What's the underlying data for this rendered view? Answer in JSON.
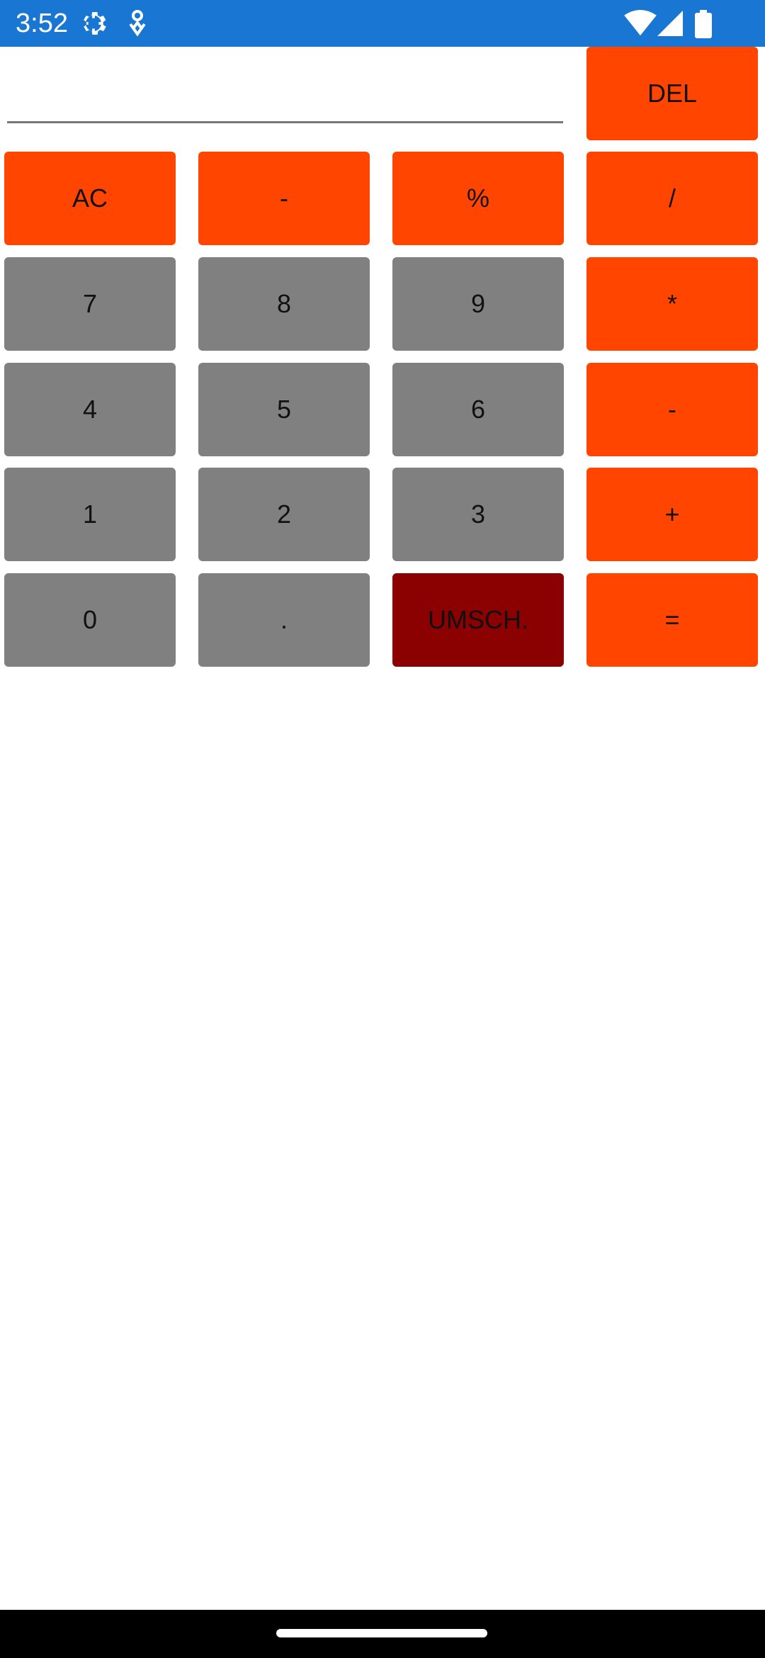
{
  "status_bar": {
    "time": "3:52",
    "left_icons": [
      "gear-icon",
      "assistant-icon"
    ],
    "right_icons": [
      "wifi-icon",
      "signal-icon",
      "battery-icon"
    ]
  },
  "display": {
    "value": "",
    "placeholder": ""
  },
  "keys": {
    "del": "DEL",
    "ac": "AC",
    "negate": "-",
    "percent": "%",
    "divide": "/",
    "seven": "7",
    "eight": "8",
    "nine": "9",
    "multiply": "*",
    "four": "4",
    "five": "5",
    "six": "6",
    "minus": "-",
    "one": "1",
    "two": "2",
    "three": "3",
    "plus": "+",
    "zero": "0",
    "dot": ".",
    "shift": "UMSCH.",
    "equals": "="
  },
  "colors": {
    "status_bar": "#1976d2",
    "operator": "#ff4500",
    "digit": "#808080",
    "shift": "#8b0000"
  }
}
